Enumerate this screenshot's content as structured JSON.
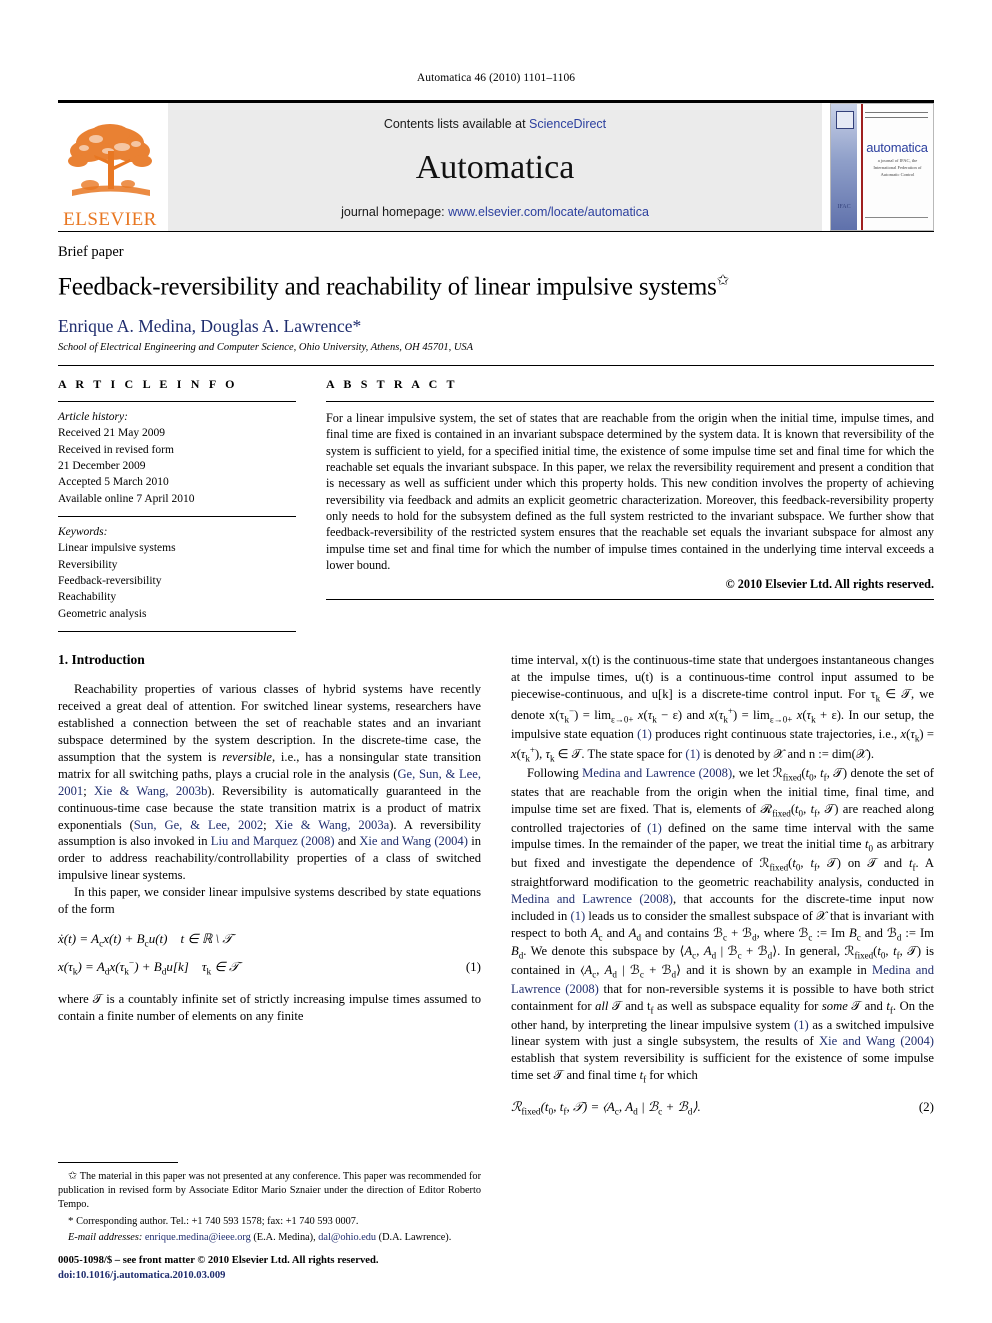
{
  "running_head": "Automatica 46 (2010) 1101–1106",
  "masthead": {
    "publisher_name": "ELSEVIER",
    "contents_prefix": "Contents lists available at ",
    "contents_link": "ScienceDirect",
    "journal_title": "Automatica",
    "homepage_prefix": "journal homepage: ",
    "homepage_link": "www.elsevier.com/locate/automatica",
    "cover": {
      "title": "automatica",
      "subtitle": "a journal of IFAC, the International Federation of Automatic Control",
      "ifac_mark": "IFAC"
    }
  },
  "article": {
    "type_label": "Brief paper",
    "title": "Feedback-reversibility and reachability of linear impulsive systems",
    "title_footnote_mark": "✩",
    "authors": "Enrique A. Medina, Douglas A. Lawrence*",
    "affiliation": "School of Electrical Engineering and Computer Science, Ohio University, Athens, OH 45701, USA"
  },
  "info": {
    "heading": "A R T I C L E    I N F O",
    "history_label": "Article history:",
    "history": [
      "Received 21 May 2009",
      "Received in revised form",
      "21 December 2009",
      "Accepted 5 March 2010",
      "Available online 7 April 2010"
    ],
    "keywords_label": "Keywords:",
    "keywords": [
      "Linear impulsive systems",
      "Reversibility",
      "Feedback-reversibility",
      "Reachability",
      "Geometric analysis"
    ]
  },
  "abstract": {
    "heading": "A B S T R A C T",
    "text": "For a linear impulsive system, the set of states that are reachable from the origin when the initial time, impulse times, and final time are fixed is contained in an invariant subspace determined by the system data. It is known that reversibility of the system is sufficient to yield, for a specified initial time, the existence of some impulse time set and final time for which the reachable set equals the invariant subspace. In this paper, we relax the reversibility requirement and present a condition that is necessary as well as sufficient under which this property holds. This new condition involves the property of achieving reversibility via feedback and admits an explicit geometric characterization. Moreover, this feedback-reversibility property only needs to hold for the subsystem defined as the full system restricted to the invariant subspace. We further show that feedback-reversibility of the restricted system ensures that the reachable set equals the invariant subspace for almost any impulse time set and final time for which the number of impulse times contained in the underlying time interval exceeds a lower bound.",
    "copyright": "© 2010 Elsevier Ltd. All rights reserved."
  },
  "body": {
    "section1_title": "1. Introduction",
    "left": {
      "p1_a": "Reachability properties of various classes of hybrid systems have recently received a great deal of attention. For switched linear systems, researchers have established a connection between the set of reachable states and an invariant subspace determined by the system description. In the discrete-time case, the assumption that the system is ",
      "p1_reversible": "reversible",
      "p1_b": ", i.e., has a nonsingular state transition matrix for all switching paths, plays a crucial role in the analysis (",
      "p1_cite1": "Ge, Sun, & Lee, 2001",
      "p1_semi": "; ",
      "p1_cite2": "Xie & Wang, 2003b",
      "p1_c": "). Reversibility is automatically guaranteed in the continuous-time case because the state transition matrix is a product of matrix exponentials (",
      "p1_cite3": "Sun, Ge, & Lee, 2002",
      "p1_cite4": "Xie & Wang, 2003a",
      "p1_d": "). A reversibility assumption is also invoked in ",
      "p1_cite5": "Liu and Marquez (2008)",
      "p1_e": " and ",
      "p1_cite6": "Xie and Wang (2004)",
      "p1_f": " in order to address reachability/controllability properties of a class of switched impulsive linear systems.",
      "p2": "In this paper, we consider linear impulsive systems described by state equations of the form",
      "eq1_line1": "ẋ(t) = A",
      "eq1_num": "(1)",
      "p3": "where 𝒯 is a countably infinite set of strictly increasing impulse times assumed to contain a finite number of elements on any finite"
    },
    "right": {
      "p1": "time interval, x(t) is the continuous-time state that undergoes instantaneous changes at the impulse times, u(t) is a continuous-time control input assumed to be piecewise-continuous, and u[k] is a discrete-time control input. For τ",
      "p1_b": ", we denote x(τ",
      "p2_lead": "Following ",
      "p2_cite": "Medina and Lawrence",
      "p2_year": " (2008)",
      "p2_a": ", we let ℛ",
      "p3_a": "to have both strict containment for ",
      "p3_all": "all",
      "p3_b": " 𝒯 and t",
      "p3_cite": "Xie and Wang (2004)",
      "eq2_num": "(2)"
    }
  },
  "footnotes": {
    "fn1_mark": "✩",
    "fn1": "The material in this paper was not presented at any conference. This paper was recommended for publication in revised form by Associate Editor Mario Sznaier under the direction of Editor Roberto Tempo.",
    "fn2_mark": "*",
    "fn2": "Corresponding author. Tel.: +1 740 593 1578; fax: +1 740 593 0007.",
    "email_label": "E-mail addresses:",
    "email1": "enrique.medina@ieee.org",
    "email1_owner": " (E.A. Medina), ",
    "email2": "dal@ohio.edu",
    "email2_owner": " (D.A. Lawrence)."
  },
  "imprint": {
    "issn_line": "0005-1098/$ – see front matter © 2010 Elsevier Ltd. All rights reserved.",
    "doi": "doi:10.1016/j.automatica.2010.03.009"
  }
}
